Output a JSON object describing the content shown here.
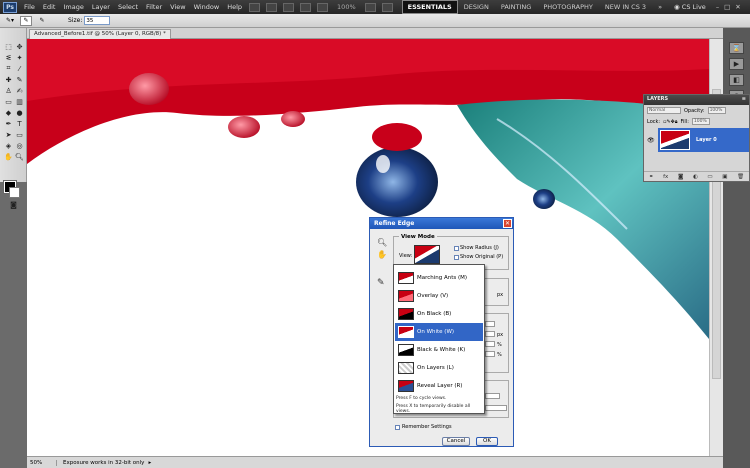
{
  "app": {
    "logo": "Ps"
  },
  "menu": {
    "items": [
      "File",
      "Edit",
      "Image",
      "Layer",
      "Select",
      "Filter",
      "View",
      "Window",
      "Help"
    ],
    "zoom": "100%"
  },
  "workspaces": {
    "active": "ESSENTIALS",
    "others": [
      "DESIGN",
      "PAINTING",
      "PHOTOGRAPHY",
      "NEW IN CS 3"
    ],
    "cs_live": "CS Live"
  },
  "options": {
    "size_label": "Size:",
    "size_value": "35"
  },
  "document": {
    "tab": "Advanced_Before1.tif @ 50% (Layer 0, RGB/8) *"
  },
  "layers": {
    "title": "LAYERS",
    "blend": "Normal",
    "opacity_label": "Opacity:",
    "opacity": "100%",
    "lock_label": "Lock:",
    "fill_label": "Fill:",
    "fill": "100%",
    "layer_name": "Layer 0",
    "footer": "fx"
  },
  "dialog": {
    "title": "Refine Edge",
    "view_mode": "View Mode",
    "view_label": "View:",
    "show_radius": "Show Radius (J)",
    "show_original": "Show Original (P)",
    "view_options": [
      "Marching Ants (M)",
      "Overlay (V)",
      "On Black (B)",
      "On White (W)",
      "Black & White (K)",
      "On Layers (L)",
      "Reveal Layer (R)"
    ],
    "selected_index": 3,
    "hint1": "Press F to cycle views.",
    "hint2": "Press X to temporarily disable all views.",
    "unit_px": "px",
    "unit_pct": "%",
    "remember": "Remember Settings",
    "cancel": "Cancel",
    "ok": "OK"
  },
  "status": {
    "zoom": "50%",
    "message": "Exposure works in 32-bit only"
  }
}
